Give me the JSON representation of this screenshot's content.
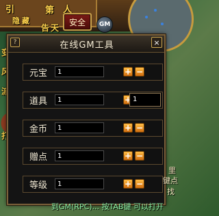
{
  "hud": {
    "glyphs": [
      "引",
      "第",
      "人",
      "隐",
      "藏",
      "告",
      "天",
      "变",
      "风",
      "派",
      "打"
    ],
    "safe_label": "安全",
    "gm_label": "GM"
  },
  "panel": {
    "title": "在线GM工具",
    "help": "?",
    "close": "×",
    "rows": [
      {
        "label": "元宝",
        "value": "1"
      },
      {
        "label": "道具",
        "value": "1"
      },
      {
        "label": "金币",
        "value": "1"
      },
      {
        "label": "赠点",
        "value": "1"
      },
      {
        "label": "等级",
        "value": "1"
      }
    ],
    "extra_value": "1",
    "plus": "+",
    "minus": "−"
  },
  "bottom": {
    "line": "到GM(RPC)... 按TAB键 可以打开",
    "side": [
      "里",
      "键点",
      "找"
    ]
  }
}
